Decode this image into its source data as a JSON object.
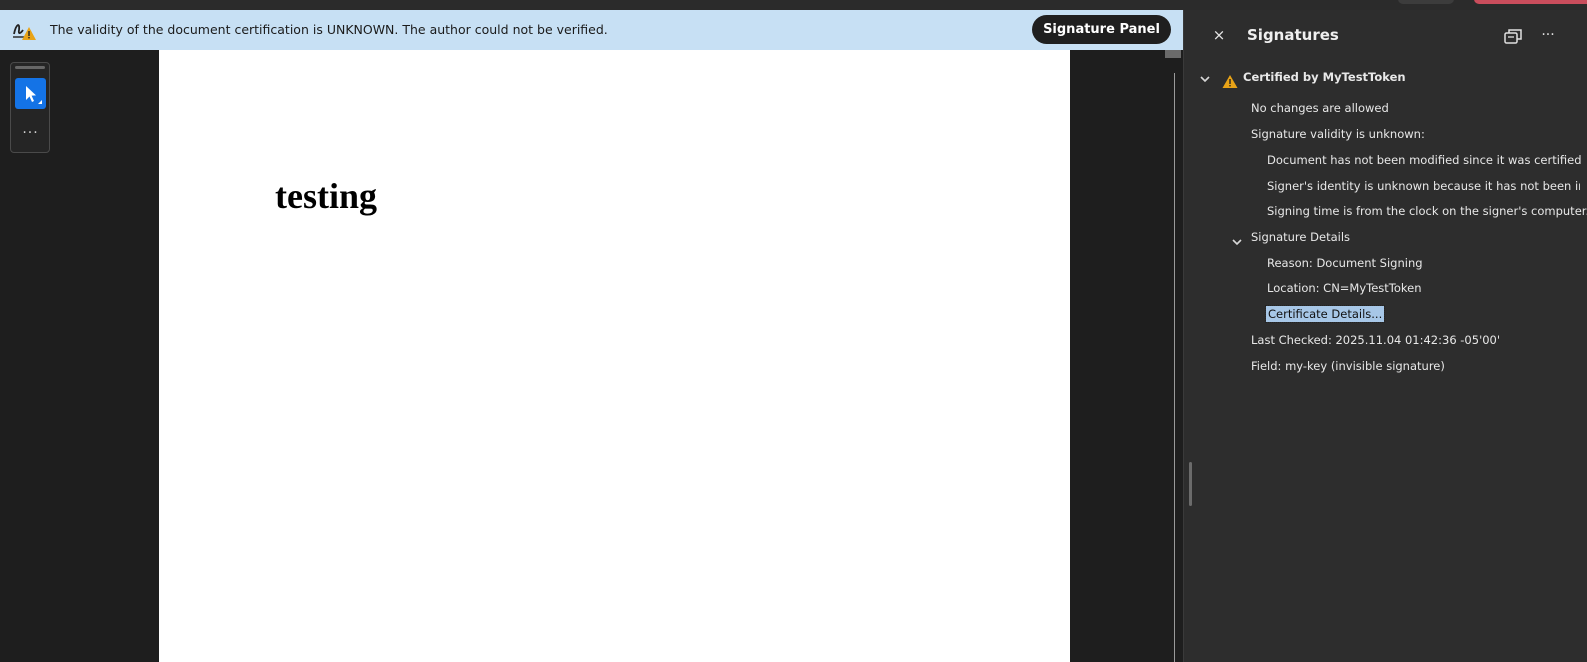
{
  "notice": {
    "text": "The validity of the document certification is UNKNOWN. The author could not be verified.",
    "button_label": "Signature Panel"
  },
  "toolbar": {
    "more_label": "···"
  },
  "document": {
    "heading": "testing"
  },
  "panel": {
    "title": "Signatures",
    "close_glyph": "×",
    "more_glyph": "···",
    "certified_by": "Certified by MyTestToken",
    "no_changes": "No changes are allowed",
    "validity_unknown": "Signature validity is unknown:",
    "not_modified": "Document has not been modified since it was certified",
    "identity_unknown": "Signer's identity is unknown because it has not been included in",
    "signing_time": "Signing time is from the clock on the signer's computer.",
    "details_header": "Signature Details",
    "reason": "Reason: Document Signing",
    "location": "Location: CN=MyTestToken",
    "certificate_details": "Certificate Details...",
    "last_checked": "Last Checked: 2025.11.04 01:42:36 -05'00'",
    "field": "Field: my-key (invisible signature)"
  },
  "colors": {
    "accent": "#1473e6",
    "notice_bg": "#c7e0f4",
    "warning": "#e8a317",
    "panel_bg": "#2d2d2d"
  },
  "icons": [
    "signature-warning-icon",
    "select-arrow-icon",
    "more-icon",
    "close-icon",
    "popout-icon",
    "chevron-down-icon",
    "warning-icon"
  ]
}
